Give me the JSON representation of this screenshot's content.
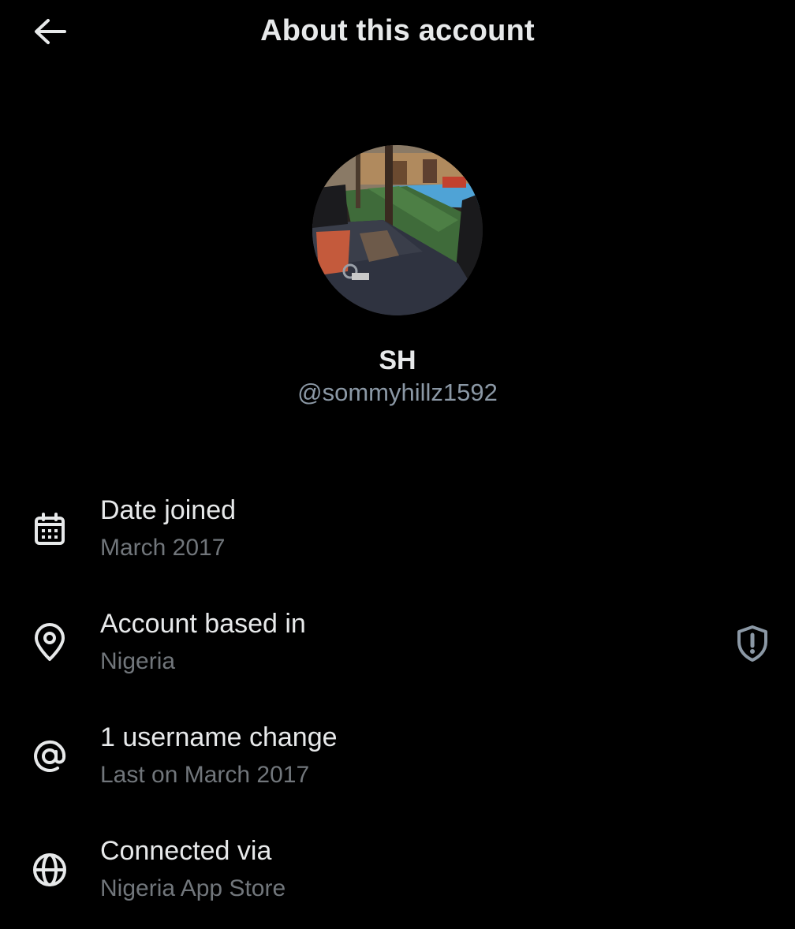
{
  "header": {
    "title": "About this account",
    "back_icon": "arrow-left-icon"
  },
  "profile": {
    "display_name": "SH",
    "handle": "@sommyhillz1592"
  },
  "details": [
    {
      "icon": "calendar-icon",
      "label": "Date joined",
      "value": "March 2017"
    },
    {
      "icon": "location-pin-icon",
      "label": "Account based in",
      "value": "Nigeria",
      "side_icon": "shield-alert-icon"
    },
    {
      "icon": "at-sign-icon",
      "label": "1 username change",
      "value": "Last on March 2017"
    },
    {
      "icon": "globe-icon",
      "label": "Connected via",
      "value": "Nigeria App Store"
    }
  ],
  "colors": {
    "background": "#000000",
    "primary_text": "#e7e9ea",
    "secondary_text": "#71767b",
    "icon": "#e7e9ea",
    "shield_icon": "#8b98a5"
  }
}
